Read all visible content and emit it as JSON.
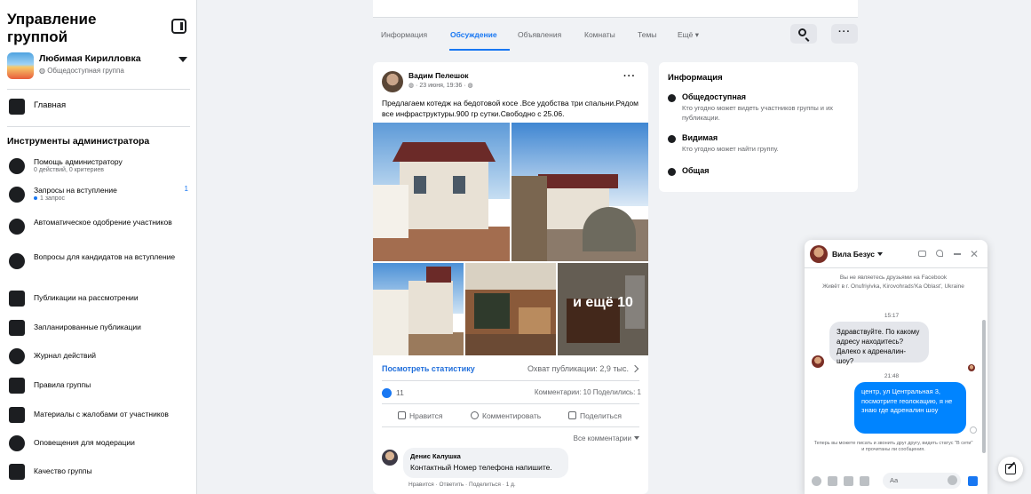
{
  "sidebar": {
    "title": "Управление группой",
    "group_name": "Любимая Кирилловка",
    "group_privacy": "Общедоступная группа",
    "home_label": "Главная",
    "tools_heading": "Инструменты администратора",
    "tools": [
      {
        "label": "Помощь администратору",
        "sub": "0 действий, 0 критериев",
        "icon": "help-icon"
      },
      {
        "label": "Запросы на вступление",
        "sub": "1 запрос",
        "badge": "1",
        "icon": "member-requests-icon"
      },
      {
        "label": "Автоматическое одобрение участников",
        "icon": "auto-approve-icon"
      },
      {
        "label": "Вопросы для кандидатов на вступление",
        "icon": "questions-icon"
      },
      {
        "label": "Публикации на рассмотрении",
        "icon": "pending-posts-icon"
      },
      {
        "label": "Запланированные публикации",
        "icon": "calendar-icon"
      },
      {
        "label": "Журнал действий",
        "icon": "activity-log-icon"
      },
      {
        "label": "Правила группы",
        "icon": "rules-icon"
      },
      {
        "label": "Материалы с жалобами от участников",
        "icon": "reports-icon"
      },
      {
        "label": "Оповещения для модерации",
        "icon": "alerts-icon"
      },
      {
        "label": "Качество группы",
        "icon": "quality-icon"
      }
    ]
  },
  "tabs": {
    "items": [
      "Информация",
      "Обсуждение",
      "Объявления",
      "Комнаты",
      "Темы",
      "Ещё"
    ],
    "active": "Обсуждение"
  },
  "post": {
    "author": "Вадим Пелешок",
    "date": "23 июня, 19:36",
    "text": "Предлагаем котедж на бедотовой косе .Все удобства три спальни.Рядом все инфраструктуры.900 гр сутки.Свободно с 25.06.",
    "more_photos": "и ещё 10",
    "stats_link": "Посмотреть статистику",
    "reach": "Охват публикации: 2,9 тыс.",
    "likes": "11",
    "comment_stats": "Комментарии: 10  Поделились: 1",
    "actions": [
      "Нравится",
      "Комментировать",
      "Поделиться"
    ],
    "all_comments": "Все комментарии",
    "comment": {
      "author": "Денис Калушка",
      "text": "Контактный Номер телефона напишите.",
      "actions": "Нравится · Ответить · Поделиться · 1 д."
    }
  },
  "info": {
    "title": "Информация",
    "items": [
      {
        "head": "Общедоступная",
        "desc": "Кто угодно может видеть участников группы и их публикации.",
        "icon": "globe-icon"
      },
      {
        "head": "Видимая",
        "desc": "Кто угодно может найти группу.",
        "icon": "eye-icon"
      },
      {
        "head": "Общая",
        "desc": "",
        "icon": "group-type-icon"
      }
    ]
  },
  "chat": {
    "name": "Вила Безус",
    "note1": "Вы не являетесь друзьями на Facebook",
    "note2": "Живёт в г. Onufriyivka, Kirovohrads'Ka Oblast', Ukraine",
    "time1": "15:17",
    "incoming": "Здравствуйте. По какому адресу находитесь? Далеко к адреналин-шоу?",
    "time2": "21:48",
    "outgoing": "центр, ул Центральная 3, посмотрите геолокацию, я не знаю где адреналин шоу",
    "footer_note": "Теперь вы можете писать и звонить друг другу, видеть статус \"В сети\" и прочитаны ли сообщения.",
    "input_placeholder": "Aa"
  },
  "colors": {
    "accent": "#1877f2",
    "outgoing_bubble": "#0084ff",
    "background": "#f0f2f5"
  }
}
